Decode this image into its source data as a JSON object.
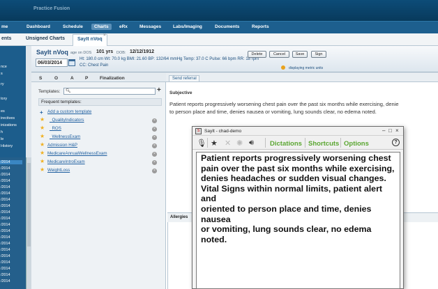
{
  "topbar": {
    "brand": "Practice Fusion"
  },
  "nav": [
    {
      "label": "me"
    },
    {
      "label": "Dashboard"
    },
    {
      "label": "Schedule"
    },
    {
      "label": "Charts"
    },
    {
      "label": "eRx"
    },
    {
      "label": "Messages"
    },
    {
      "label": "Labs/Imaging"
    },
    {
      "label": "Documents"
    },
    {
      "label": "Reports"
    }
  ],
  "tabs": [
    {
      "label": "ents"
    },
    {
      "label": "Unsigned Charts"
    },
    {
      "label": "SayIt nVoq"
    }
  ],
  "sidebar": {
    "items": [
      "nce",
      "s",
      "ry",
      "tory",
      "es",
      "irectives",
      "inizations",
      "h",
      "le",
      "History"
    ],
    "dates": [
      "/2014",
      "/2014",
      "/2014",
      "/2014",
      "/2014",
      "/2014",
      "/2014",
      "/2014",
      "/2014",
      "/2014",
      "/2014",
      "/2014",
      "/2014",
      "/2014",
      "/2014",
      "/2014",
      "/2014",
      "/2014",
      "/2014",
      "/2014",
      "/2014",
      "/2014"
    ]
  },
  "patient": {
    "name": "SayIt nVoq",
    "age_on_dos": "age on DOS",
    "age": "101 yrs",
    "dob_label": "DOB:",
    "dob": "12/12/1912",
    "visit_date": "06/03/2014",
    "vitals_line1": "Ht: 180.0 cm  Wt: 70.0 kg  BMI: 21.60  BP: 132/64 mmHg  Temp: 37.0 C  Pulse: 66 bpm  RR: 18 rpm",
    "cc": "CC: Chest Pain",
    "metric_note": "displaying metric units"
  },
  "header_buttons": [
    "Delete",
    "Cancel",
    "Save",
    "Sign"
  ],
  "soap_tabs": [
    "S",
    "O",
    "A",
    "P",
    "Finalization"
  ],
  "send_referral": "Send referral",
  "templates": {
    "label": "Templates:",
    "frequent": "Frequent templates:",
    "add": "Add a custom template",
    "items": [
      "_QualityIndicators",
      "_ROS",
      "_WellnessExam",
      "Admission H&P",
      "MedicareAnnualWellnessExam",
      "MedicareIntroExam",
      "WeightLoss"
    ]
  },
  "note": {
    "section": "Subjective",
    "line1": "Patient reports progressively worsening chest pain over the past six months while exercising, denie",
    "line2": "to person place and time, denies nausea or vomiting, lung sounds clear, no edema noted.",
    "allergies": "Allergies"
  },
  "dialog": {
    "title": "SayIt - chad-demo",
    "dictations": "Dictations",
    "shortcuts": "Shortcuts",
    "options": "Options",
    "lines": [
      "Patient reports progressively worsening chest",
      "pain over the past six months while exercising,",
      "denies headaches or sudden visual changes.",
      "Vital Signs within normal limits, patient alert and",
      "oriented to person place and time, denies nausea",
      "or vomiting, lung sounds clear, no edema noted."
    ]
  }
}
